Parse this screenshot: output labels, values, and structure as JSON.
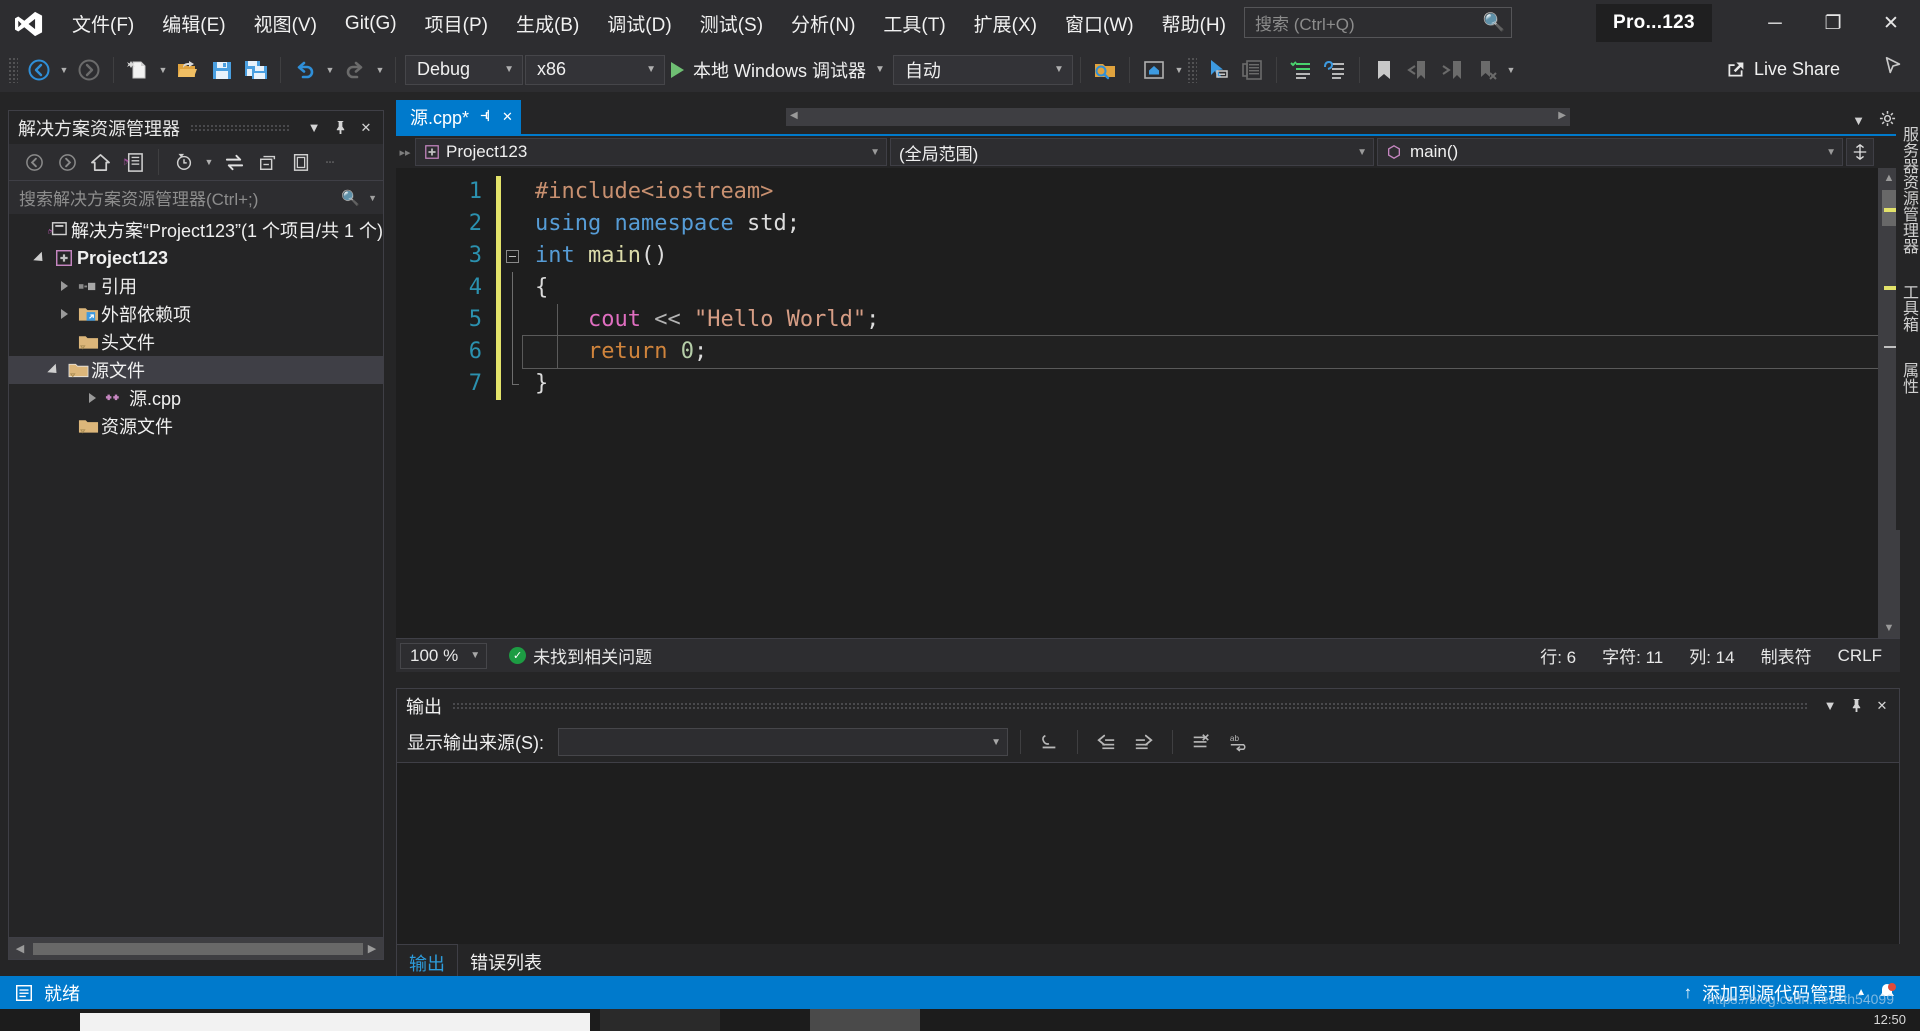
{
  "window": {
    "project_chip": "Pro...123",
    "minimize": "─",
    "maximize": "❐",
    "close": "✕"
  },
  "menu": {
    "items": [
      {
        "label": "文件(F)",
        "name": "menu-file"
      },
      {
        "label": "编辑(E)",
        "name": "menu-edit"
      },
      {
        "label": "视图(V)",
        "name": "menu-view"
      },
      {
        "label": "Git(G)",
        "name": "menu-git"
      },
      {
        "label": "项目(P)",
        "name": "menu-project"
      },
      {
        "label": "生成(B)",
        "name": "menu-build"
      },
      {
        "label": "调试(D)",
        "name": "menu-debug"
      },
      {
        "label": "测试(S)",
        "name": "menu-test"
      },
      {
        "label": "分析(N)",
        "name": "menu-analyze"
      },
      {
        "label": "工具(T)",
        "name": "menu-tools"
      },
      {
        "label": "扩展(X)",
        "name": "menu-extensions"
      },
      {
        "label": "窗口(W)",
        "name": "menu-window"
      },
      {
        "label": "帮助(H)",
        "name": "menu-help"
      }
    ]
  },
  "search": {
    "placeholder": "搜索 (Ctrl+Q)",
    "icon": "search-icon"
  },
  "toolbar": {
    "config": "Debug",
    "platform": "x86",
    "run_label": "本地 Windows 调试器",
    "solution_config_label": "自动",
    "live_share": "Live Share"
  },
  "solution_explorer": {
    "title": "解决方案资源管理器",
    "search_placeholder": "搜索解决方案资源管理器(Ctrl+;)",
    "tree": [
      {
        "label": "解决方案“Project123”(1 个项目/共 1 个)",
        "indent": 0,
        "twisty": "none",
        "icon": "solution-icon",
        "bold": false,
        "selected": false,
        "name": "tree-item-solution"
      },
      {
        "label": "Project123",
        "indent": 1,
        "twisty": "down",
        "icon": "project-icon",
        "bold": true,
        "selected": false,
        "name": "tree-item-project"
      },
      {
        "label": "引用",
        "indent": 2,
        "twisty": "right",
        "icon": "references-icon",
        "bold": false,
        "selected": false,
        "name": "tree-item-references"
      },
      {
        "label": "外部依赖项",
        "indent": 2,
        "twisty": "right",
        "icon": "folder-ext-icon",
        "bold": false,
        "selected": false,
        "name": "tree-item-external-deps"
      },
      {
        "label": "头文件",
        "indent": 2,
        "twisty": "none",
        "icon": "folder-icon",
        "bold": false,
        "selected": false,
        "name": "tree-item-header-files"
      },
      {
        "label": "源文件",
        "indent": 2,
        "twisty": "down",
        "icon": "folder-open-icon",
        "bold": false,
        "selected": true,
        "name": "tree-item-source-files"
      },
      {
        "label": "源.cpp",
        "indent": 3,
        "twisty": "right",
        "icon": "cpp-file-icon",
        "bold": false,
        "selected": false,
        "name": "tree-item-source-cpp"
      },
      {
        "label": "资源文件",
        "indent": 2,
        "twisty": "none",
        "icon": "folder-icon",
        "bold": false,
        "selected": false,
        "name": "tree-item-resource-files"
      }
    ]
  },
  "editor": {
    "tab_label": "源.cpp*",
    "nav_project": "Project123",
    "nav_scope": "(全局范围)",
    "nav_member": "main()",
    "line_numbers": [
      "1",
      "2",
      "3",
      "4",
      "5",
      "6",
      "7"
    ],
    "code_lines": [
      {
        "n": 1,
        "tokens": [
          {
            "t": "#include",
            "c": "k-pre"
          },
          {
            "t": "<iostream>",
            "c": "k-pre"
          }
        ]
      },
      {
        "n": 2,
        "tokens": [
          {
            "t": "using",
            "c": "k-kw"
          },
          {
            "t": " ",
            "c": "k-punc"
          },
          {
            "t": "namespace",
            "c": "k-kw"
          },
          {
            "t": " ",
            "c": "k-punc"
          },
          {
            "t": "std",
            "c": "k-id"
          },
          {
            "t": ";",
            "c": "k-punc"
          }
        ]
      },
      {
        "n": 3,
        "tokens": [
          {
            "t": "int",
            "c": "k-type"
          },
          {
            "t": " ",
            "c": "k-punc"
          },
          {
            "t": "main",
            "c": "k-fn"
          },
          {
            "t": "()",
            "c": "k-punc"
          }
        ]
      },
      {
        "n": 4,
        "tokens": [
          {
            "t": "{",
            "c": "k-punc"
          }
        ]
      },
      {
        "n": 5,
        "tokens": [
          {
            "t": "    ",
            "c": "k-punc"
          },
          {
            "t": "cout",
            "c": "k-obj"
          },
          {
            "t": " ",
            "c": "k-punc"
          },
          {
            "t": "<<",
            "c": "k-op"
          },
          {
            "t": " ",
            "c": "k-punc"
          },
          {
            "t": "\"Hello World\"",
            "c": "k-str"
          },
          {
            "t": ";",
            "c": "k-punc"
          }
        ]
      },
      {
        "n": 6,
        "tokens": [
          {
            "t": "    ",
            "c": "k-punc"
          },
          {
            "t": "return",
            "c": "k-ret"
          },
          {
            "t": " ",
            "c": "k-punc"
          },
          {
            "t": "0",
            "c": "k-num"
          },
          {
            "t": ";",
            "c": "k-punc"
          }
        ]
      },
      {
        "n": 7,
        "tokens": [
          {
            "t": "}",
            "c": "k-punc"
          }
        ]
      }
    ],
    "status": {
      "zoom": "100 %",
      "issues": "未找到相关问题",
      "line": "行: 6",
      "chars": "字符: 11",
      "col": "列: 14",
      "tabs": "制表符",
      "eol": "CRLF"
    }
  },
  "output": {
    "title": "输出",
    "source_label": "显示输出来源(S):",
    "source_value": "",
    "body_text": ""
  },
  "bottom_tabs": [
    {
      "label": "输出",
      "active": true,
      "name": "bottom-tab-output"
    },
    {
      "label": "错误列表",
      "active": false,
      "name": "bottom-tab-error-list"
    }
  ],
  "statusbar": {
    "ready": "就绪",
    "source_control": "添加到源代码管理",
    "watermark": "https://blog.csdn.net/sth54099"
  },
  "right_dock": [
    {
      "label": "服务器资源管理器",
      "name": "dock-server-explorer"
    },
    {
      "label": "工具箱",
      "name": "dock-toolbox"
    },
    {
      "label": "属性",
      "name": "dock-properties"
    }
  ],
  "colors": {
    "accent": "#007acc",
    "chrome": "#2d2d30",
    "panel": "#252526",
    "editor_bg": "#1e1e1e",
    "line_number": "#2b91af",
    "string": "#d69d85",
    "keyword": "#569cd6"
  },
  "taskbar": {
    "clock": "12:50"
  }
}
